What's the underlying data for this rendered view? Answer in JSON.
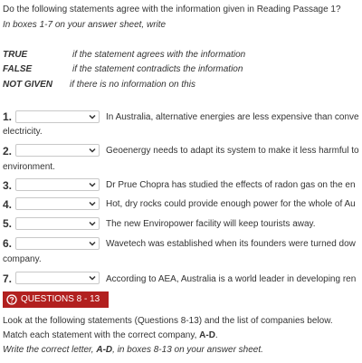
{
  "instructions": {
    "line1": "Do the following statements agree with the information given in Reading Passage 1?",
    "line2": "In boxes 1-7 on your answer sheet, write"
  },
  "definitions": [
    {
      "term": "TRUE",
      "desc": "if the statement agrees with the information"
    },
    {
      "term": "FALSE",
      "desc": "if the statement contradicts the information"
    },
    {
      "term": "NOT GIVEN",
      "desc": "if there is no information on this"
    }
  ],
  "questions": [
    {
      "number": "1.",
      "text": "In Australia, alternative energies are less expensive than conve",
      "cont": "electricity."
    },
    {
      "number": "2.",
      "text": "Geoenergy needs to adapt its system to make it less harmful to",
      "cont": "environment."
    },
    {
      "number": "3.",
      "text": "Dr Prue Chopra has studied the effects of radon gas on the en",
      "cont": ""
    },
    {
      "number": "4.",
      "text": "Hot, dry rocks could provide enough power for the whole of Au",
      "cont": ""
    },
    {
      "number": "5.",
      "text": "The new Enviropower facility will keep tourists away.",
      "cont": ""
    },
    {
      "number": "6.",
      "text": "Wavetech was established when its founders were turned dow",
      "cont": "company."
    },
    {
      "number": "7.",
      "text": "According to AEA, Australia is a world leader in developing ren",
      "cont": ""
    }
  ],
  "section2": {
    "banner": "QUESTIONS 8 - 13",
    "line1": "Look at the following statements (Questions 8-13) and the list of companies below.",
    "line2_pre": "Match each statement with the correct company, ",
    "line2_bold": "A-D",
    "line2_post": ".",
    "line3_pre": "Write the correct letter, ",
    "line3_bold": "A-D",
    "line3_post": ", in boxes 8-13 on your answer sheet."
  },
  "colors": {
    "accent": "#b2201f",
    "text": "#333333"
  }
}
